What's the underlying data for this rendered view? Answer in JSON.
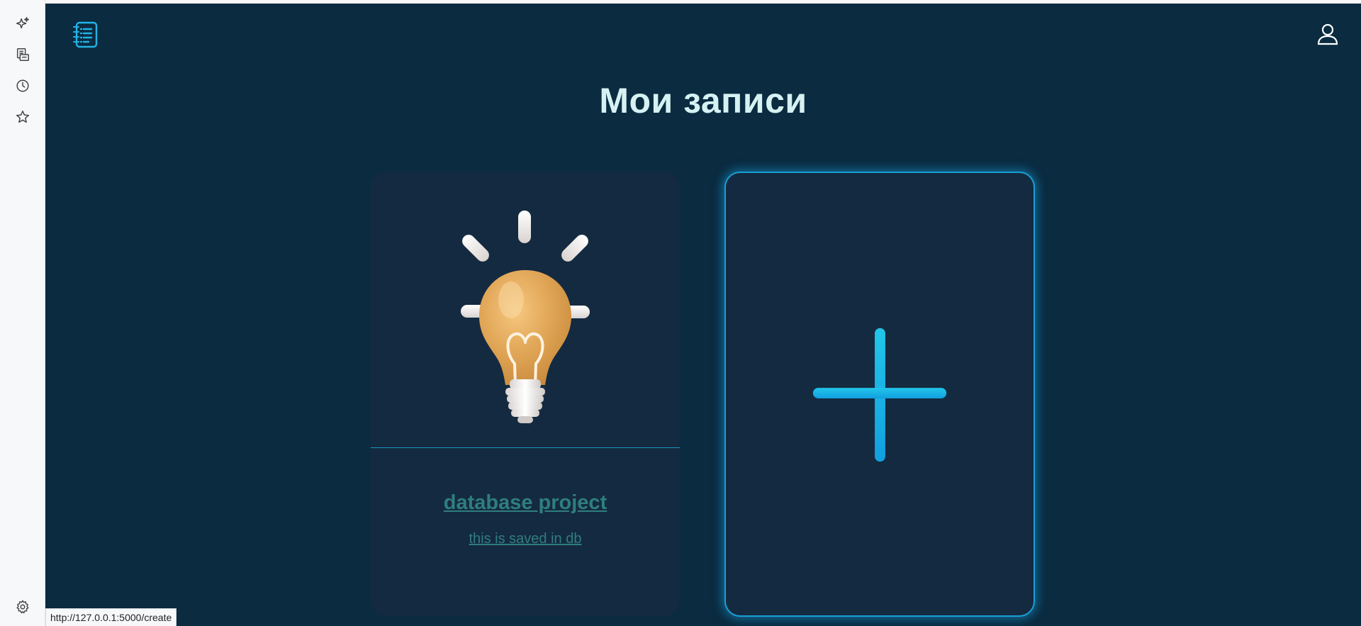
{
  "page": {
    "title": "Мои записи"
  },
  "notes": [
    {
      "title": "database project",
      "description": "this is saved in db",
      "image": "lightbulb-illustration"
    }
  ],
  "add_card": {
    "icon": "plus-icon"
  },
  "rail": {
    "items": [
      {
        "icon": "sparkle-icon"
      },
      {
        "icon": "pages-icon"
      },
      {
        "icon": "history-icon"
      },
      {
        "icon": "favorites-icon"
      }
    ],
    "bottom_icon": "settings-icon"
  },
  "status_bar": {
    "url": "http://127.0.0.1:5000/create"
  },
  "colors": {
    "page_bg": "#0a2b40",
    "card_bg": "#142a40",
    "accent": "#1a9fd6",
    "title": "#d6f1f2",
    "link": "#2f7e7e"
  }
}
